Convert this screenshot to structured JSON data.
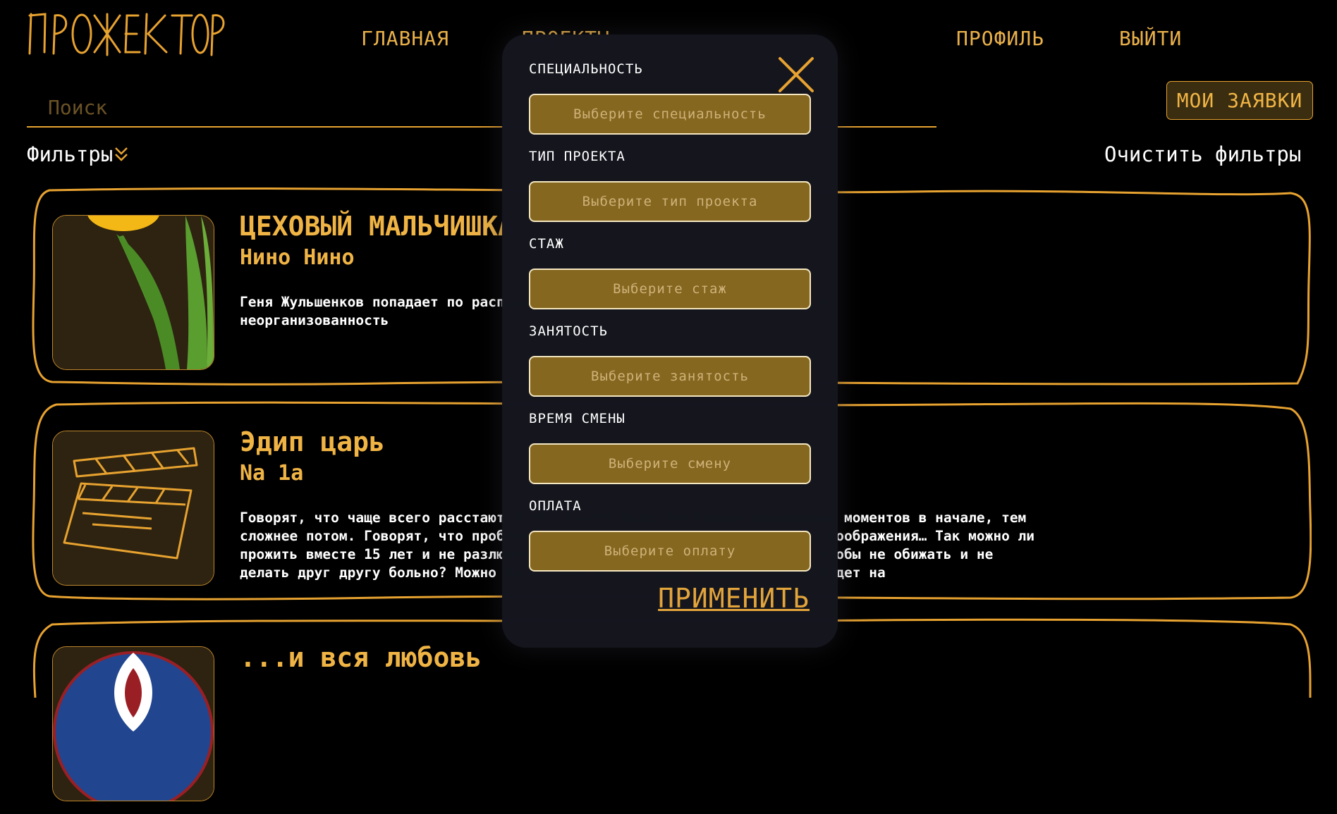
{
  "header": {
    "logo": "ПРОЖЕКТОР",
    "nav": {
      "home": "ГЛАВНАЯ",
      "projects": "ПРОЕКТЫ",
      "profile": "ПРОФИЛЬ",
      "logout": "ВЫЙТИ"
    }
  },
  "search": {
    "placeholder": "Поиск"
  },
  "my_requests": "МОИ ЗАЯВКИ",
  "filters": {
    "label": "Фильтры",
    "clear": "Очистить фильтры"
  },
  "projects": [
    {
      "title": "ЦЕХОВЫЙ МАЛЬЧИШКА",
      "author": "Нино Нино",
      "description": "Геня Жульшенков попадает по распределению в цех, где царит безвластие и\nнеорганизованность",
      "image": "tulip-image"
    },
    {
      "title": "Эдип царь",
      "author": "Na 1a",
      "description": "Говорят, что чаще всего расстаются те, у кого было чем больше прекрасных моментов в начале, тем\nсложнее потом. Говорят, что проблемы в отношениях только от недостатка воображения… Так можно ли\nпрожить вместе 15 лет и не разлюбить друг друга? Можно ли любить так, чтобы не обижать и не\nделать друг другу больно? Можно ли сохранять веру друг в друга? И что будет на",
      "image": "clapperboard-image"
    },
    {
      "title": "...и вся любовь",
      "author": "",
      "description": "",
      "image": "circle-image"
    }
  ],
  "filter_modal": {
    "fields": [
      {
        "label": "СПЕЦИАЛЬНОСТЬ",
        "placeholder": "Выберите специальность"
      },
      {
        "label": "ТИП ПРОЕКТА",
        "placeholder": "Выберите тип проекта"
      },
      {
        "label": "СТАЖ",
        "placeholder": "Выберите стаж"
      },
      {
        "label": "ЗАНЯТОСТЬ",
        "placeholder": "Выберите занятость"
      },
      {
        "label": "ВРЕМЯ СМЕНЫ",
        "placeholder": "Выберите смену"
      },
      {
        "label": "ОПЛАТА",
        "placeholder": "Выберите оплату"
      }
    ],
    "apply": "ПРИМЕНИТЬ"
  },
  "colors": {
    "accent": "#e7a230",
    "background": "#000000",
    "modal": "#14161e",
    "select_fill": "#85671f"
  }
}
